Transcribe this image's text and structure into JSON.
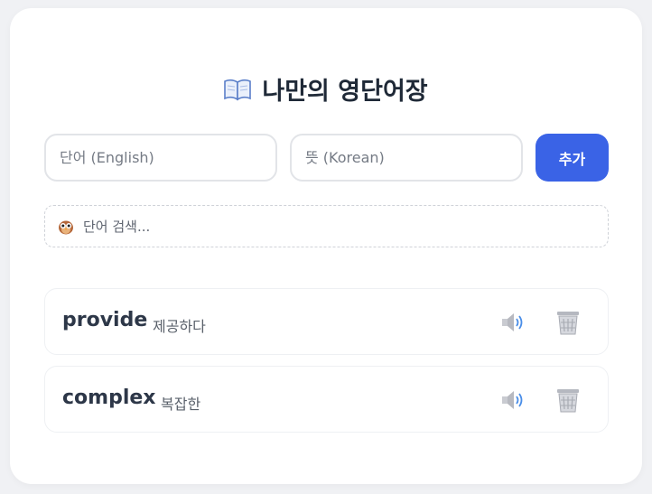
{
  "header": {
    "title": "나만의 영단어장",
    "icon": "open-book-icon"
  },
  "form": {
    "word_placeholder": "단어 (English)",
    "meaning_placeholder": "뜻 (Korean)",
    "add_label": "추가",
    "accent_color": "#3a63e6"
  },
  "search": {
    "icon": "owl-icon",
    "placeholder": "단어 검색..."
  },
  "words": [
    {
      "word": "provide",
      "meaning": "제공하다",
      "speak_icon": "speaker-icon",
      "delete_icon": "trash-icon"
    },
    {
      "word": "complex",
      "meaning": "복잡한",
      "speak_icon": "speaker-icon",
      "delete_icon": "trash-icon"
    }
  ]
}
